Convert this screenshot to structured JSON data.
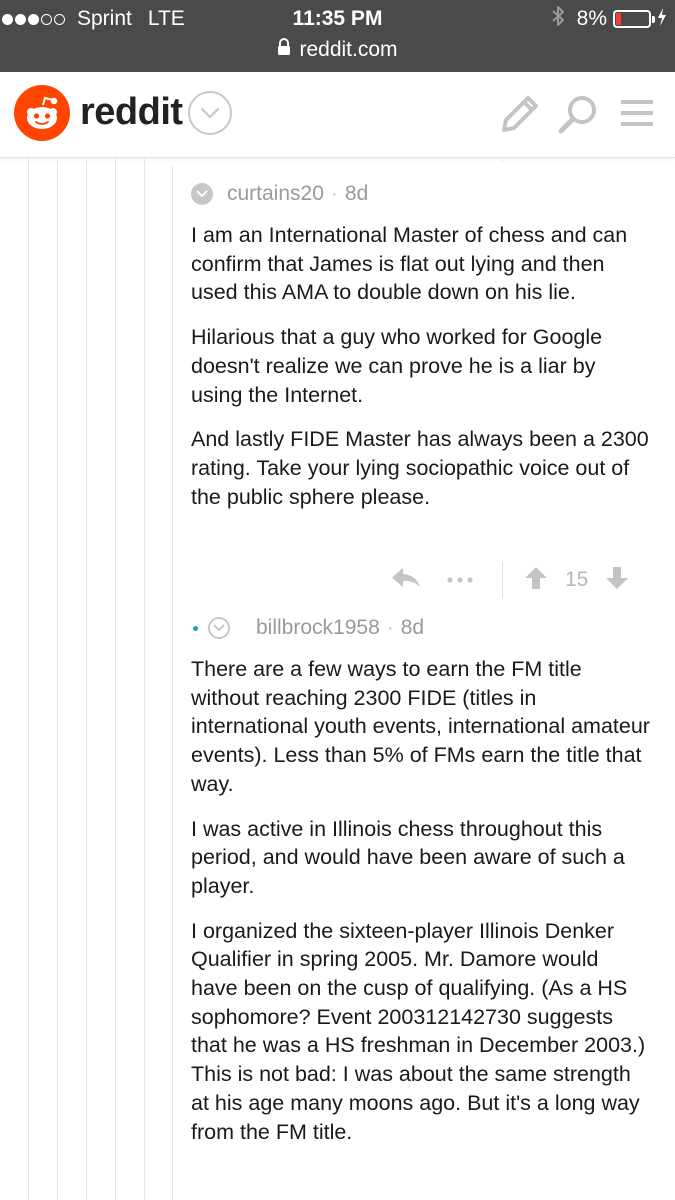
{
  "status_bar": {
    "carrier": "Sprint",
    "network": "LTE",
    "time": "11:35 PM",
    "battery": "8%",
    "url": "reddit.com",
    "signal_bars_filled": 3,
    "signal_bars_total": 5
  },
  "header": {
    "wordmark": "reddit",
    "icons": [
      "reddit-alien-logo",
      "chevron-down-icon",
      "pencil-icon",
      "search-icon",
      "menu-icon"
    ]
  },
  "comments": [
    {
      "author": "curtains20",
      "age": "8d",
      "paragraphs": [
        "I am an International Master of chess and can confirm that James is flat out lying and then used this AMA to double down on his lie.",
        "Hilarious that a guy who worked for Google doesn't realize we can prove he is a liar by using the Internet.",
        "And lastly FIDE Master has always been a 2300 rating. Take your lying sociopathic voice out of the public sphere please."
      ],
      "score": "15",
      "action_icons": [
        "reply-icon",
        "more-icon",
        "upvote-icon",
        "downvote-icon"
      ]
    },
    {
      "author": "billbrock1958",
      "age": "8d",
      "paragraphs": [
        "There are a few ways to earn the FM title without reaching 2300 FIDE (titles in international youth events, international amateur events). Less than 5% of FMs earn the title that way.",
        "I was active in Illinois chess throughout this period, and would have been aware of such a player.",
        "I organized the sixteen-player Illinois Denker Qualifier in spring 2005. Mr. Damore would have been on the cusp of qualifying. (As a HS sophomore? Event 200312142730 suggests that he was a HS freshman in December 2003.) This is not bad: I was about the same strength at his age many moons ago. But it's a long way from the FM title."
      ]
    }
  ],
  "colors": {
    "status_bar_bg": "#4a4a4a",
    "reddit_orange": "#ff4500",
    "meta_gray": "#9a9a9a",
    "body_text": "#1a1a1b",
    "new_comment_dot": "#24a0a0",
    "battery_low": "#ff3b30"
  }
}
